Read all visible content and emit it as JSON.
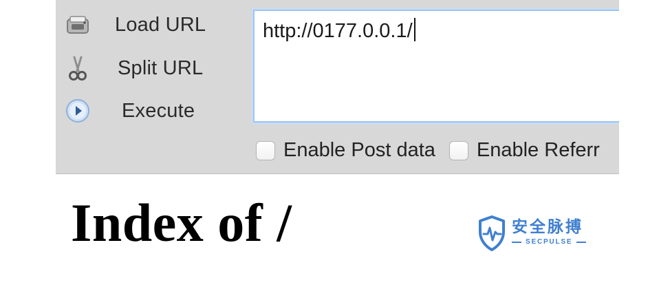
{
  "toolbar": {
    "commands": [
      {
        "label": "Load URL",
        "icon": "load-url-icon"
      },
      {
        "label": "Split URL",
        "icon": "scissors-icon"
      },
      {
        "label": "Execute",
        "icon": "play-icon"
      }
    ],
    "url_value": "http://0177.0.0.1/",
    "checkboxes": [
      {
        "label": "Enable Post data",
        "checked": false
      },
      {
        "label": "Enable Referr",
        "checked": false
      }
    ]
  },
  "page": {
    "heading": "Index of /"
  },
  "watermark": {
    "chinese": "安全脉搏",
    "english": "SECPULSE",
    "color": "#3f7fd0"
  }
}
